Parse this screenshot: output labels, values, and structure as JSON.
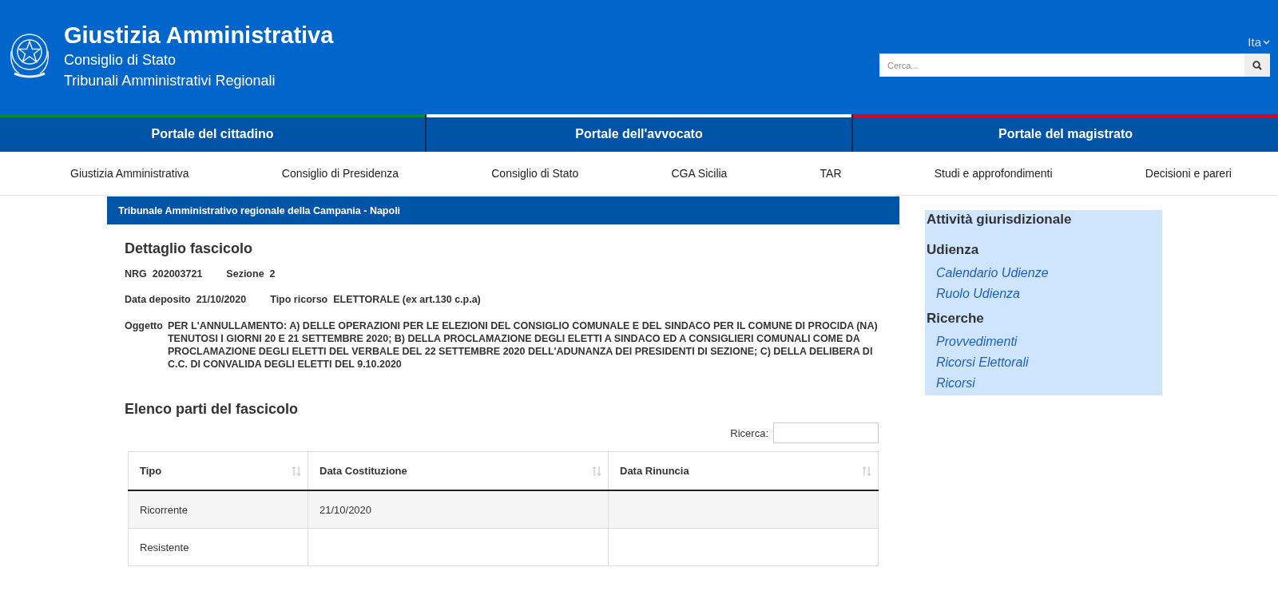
{
  "header": {
    "title": "Giustizia Amministrativa",
    "subtitles": [
      "Consiglio di Stato",
      "Tribunali Amministrativi Regionali"
    ],
    "language": "Ita",
    "search": {
      "placeholder": "Cerca..."
    }
  },
  "portals": [
    {
      "label": "Portale del cittadino",
      "color": "#008c2d"
    },
    {
      "label": "Portale dell'avvocato",
      "color": "#ffffff"
    },
    {
      "label": "Portale del magistrato",
      "color": "#e2001a"
    }
  ],
  "nav": [
    "Giustizia Amministrativa",
    "Consiglio di Presidenza",
    "Consiglio di Stato",
    "CGA Sicilia",
    "TAR",
    "Studi e approfondimenti",
    "Decisioni e pareri"
  ],
  "court": "Tribunale Amministrativo regionale della Campania - Napoli",
  "detail": {
    "title": "Dettaglio fascicolo",
    "rows": [
      [
        {
          "label": "NRG",
          "value": "202003721"
        },
        {
          "label": "Sezione",
          "value": "2"
        }
      ],
      [
        {
          "label": "Data deposito",
          "value": "21/10/2020"
        },
        {
          "label": "Tipo ricorso",
          "value": "ELETTORALE (ex art.130 c.p.a)"
        }
      ]
    ],
    "subject": {
      "label": "Oggetto",
      "value": "PER L'ANNULLAMENTO: A) DELLE OPERAZIONI PER LE ELEZIONI DEL CONSIGLIO COMUNALE E DEL SINDACO PER IL COMUNE DI PROCIDA (NA) TENUTOSI I GIORNI 20 E 21 SETTEMBRE 2020; B) DELLA PROCLAMAZIONE DEGLI ELETTI A SINDACO ED A CONSIGLIERI COMUNALI COME DA PROCLAMAZIONE DEGLI ELETTI DEL VERBALE DEL 22 SETTEMBRE 2020 DELL'ADUNANZA DEI PRESIDENTI DI SEZIONE; C) DELLA DELIBERA DI C.C. DI CONVALIDA DEGLI ELETTI DEL 9.10.2020"
    }
  },
  "parties": {
    "title": "Elenco parti del fascicolo",
    "search_label": "Ricerca:",
    "table": {
      "columns": [
        "Tipo",
        "Data Costituzione",
        "Data Rinuncia"
      ],
      "rows": [
        [
          "Ricorrente",
          "21/10/2020",
          ""
        ],
        [
          "Resistente",
          "",
          ""
        ]
      ]
    }
  },
  "sidebar": {
    "title": "Attività giurisdizionale",
    "sections": [
      {
        "title": "Udienza",
        "links": [
          "Calendario Udienze",
          "Ruolo Udienza"
        ]
      },
      {
        "title": "Ricerche",
        "links": [
          "Provvedimenti",
          "Ricorsi Elettorali",
          "Ricorsi"
        ]
      }
    ]
  }
}
